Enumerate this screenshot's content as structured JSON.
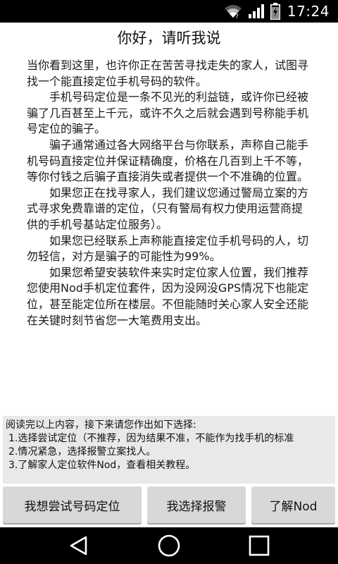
{
  "status_bar": {
    "time": "17:24",
    "icons": [
      "wifi-icon",
      "signal-icon",
      "battery-charging-icon"
    ]
  },
  "title": "你好，请听我说",
  "article": {
    "paragraphs": [
      "当你看到这里，也许你正在苦苦寻找走失的家人，试图寻找一个能直接定位手机号码的软件。",
      "手机号码定位是一条不见光的利益链，或许你已经被骗了几百甚至上千元，或许不久之后就会遇到号称能手机号定位的骗子。",
      "骗子通常通过各大网络平台与你联系，声称自己能手机号码直接定位并保证精确度，价格在几百到上千不等，等你付钱之后骗子直接消失或者提供一个不准确的位置。",
      "如果您正在找寻家人，我们建议您通过警局立案的方式寻求免费靠谱的定位，（只有警局有权力使用运营商提供的手机号基站定位服务）。",
      "如果您已经联系上声称能直接定位手机号码的人，切勿轻信，对方是骗子的可能性为99%。",
      "如果您希望安装软件来实时定位家人位置，我们推荐您使用Nod手机定位套件，因为没网没GPS情况下也能定位，甚至能定位所在楼层。不但能随时关心家人安全还能在关键时刻节省您一大笔费用支出。"
    ]
  },
  "choices": {
    "intro": "阅读完以上内容，接下来请您作出如下选择:",
    "items": [
      "1.选择尝试定位（不推荐，因为结果不准，不能作为找手机的标准",
      "2.情况紧急，选择报警立案找人。",
      "3.了解家人定位软件Nod，查看相关教程。"
    ]
  },
  "buttons": {
    "try_locate": "我想尝试号码定位",
    "report_police": "我选择报警",
    "learn_nod": "了解Nod"
  },
  "nav_bar": {
    "icons": [
      "back-icon",
      "home-icon",
      "recent-apps-icon"
    ]
  }
}
